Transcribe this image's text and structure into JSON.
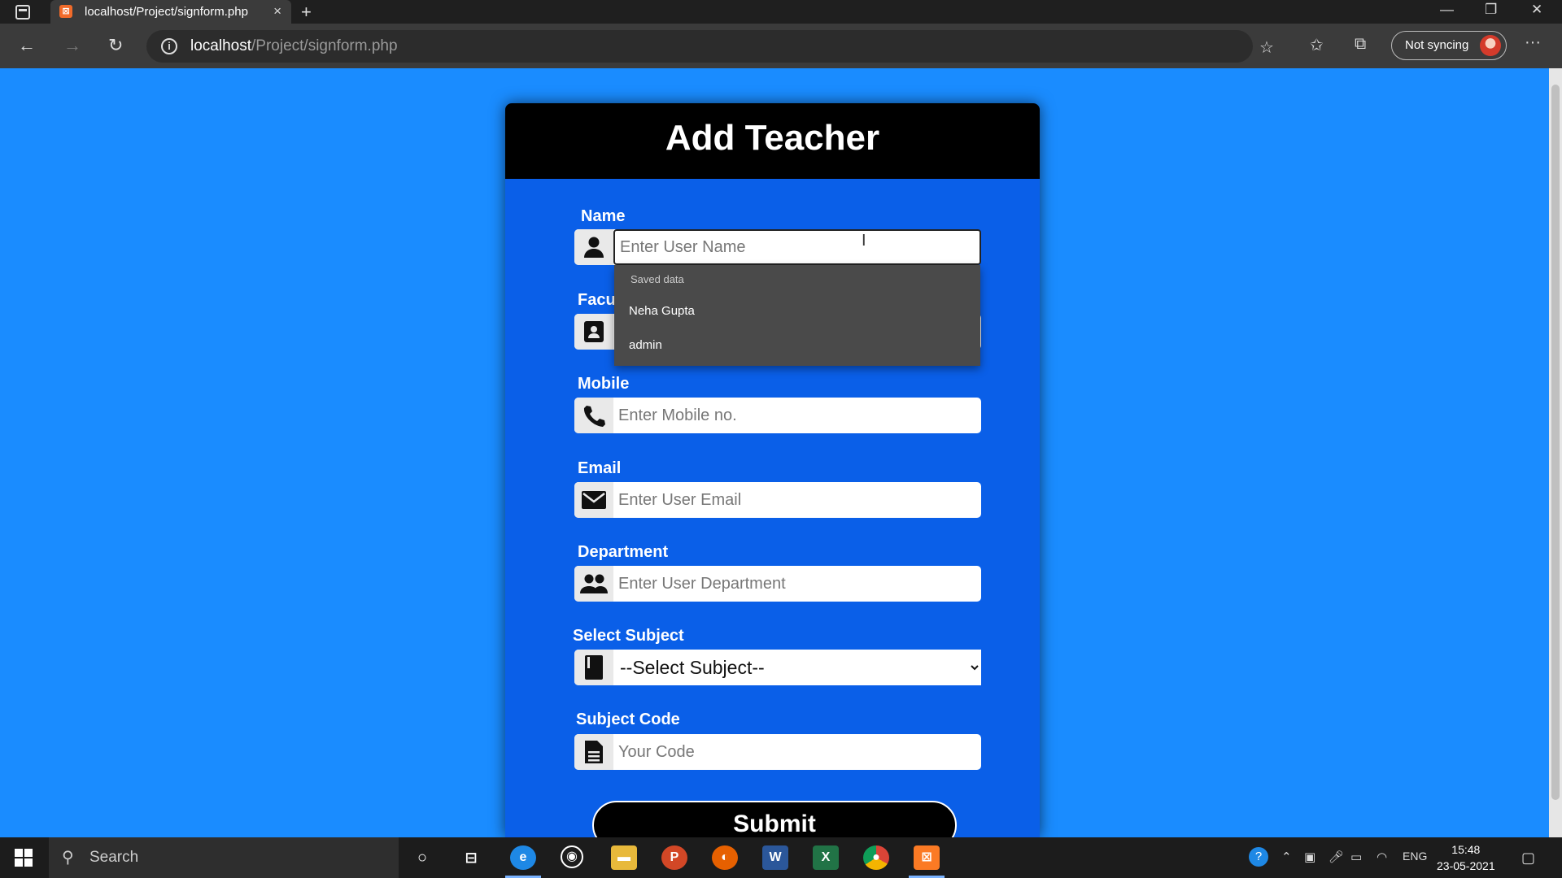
{
  "browser": {
    "tab_title": "localhost/Project/signform.php",
    "tab_close": "×",
    "new_tab": "+",
    "url_host": "localhost",
    "url_path": "/Project/signform.php",
    "sync_label": "Not syncing",
    "more": "···",
    "minimize": "—",
    "restore": "❐",
    "close": "✕"
  },
  "form": {
    "title": "Add Teacher",
    "name_label": "Name",
    "name_placeholder": "Enter User Name",
    "faculty_label_partial": "Facu",
    "mobile_label": "Mobile",
    "mobile_placeholder": "Enter Mobile no.",
    "email_label": "Email",
    "email_placeholder": "Enter User Email",
    "department_label": "Department",
    "department_placeholder": "Enter User Department",
    "subject_label": "Select Subject",
    "subject_selected": "--Select Subject--",
    "code_label": "Subject Code",
    "code_placeholder": "Your Code",
    "submit_label": "Submit"
  },
  "autofill": {
    "header": "Saved data",
    "items": [
      "Neha Gupta",
      "admin"
    ]
  },
  "taskbar": {
    "search_label": "Search",
    "lang": "ENG",
    "time": "15:48",
    "date": "23-05-2021"
  },
  "colors": {
    "page_bg": "#1a8cff",
    "card_bg": "#0a5fe8",
    "header_bg": "#000000"
  }
}
